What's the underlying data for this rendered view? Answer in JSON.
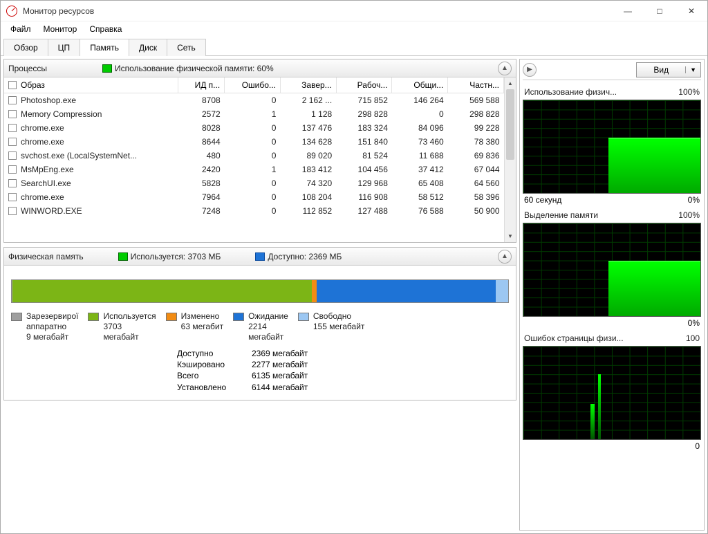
{
  "window": {
    "title": "Монитор ресурсов"
  },
  "menu": {
    "file": "Файл",
    "monitor": "Монитор",
    "help": "Справка"
  },
  "tabs": {
    "overview": "Обзор",
    "cpu": "ЦП",
    "memory": "Память",
    "disk": "Диск",
    "network": "Сеть"
  },
  "processes": {
    "title": "Процессы",
    "usage_label": "Использование физической памяти: 60%",
    "columns": {
      "image": "Образ",
      "pid": "ИД п...",
      "faults": "Ошибо...",
      "commit": "Завер...",
      "working": "Рабоч...",
      "shared": "Общи...",
      "private": "Частн..."
    },
    "rows": [
      {
        "image": "Photoshop.exe",
        "pid": "8708",
        "faults": "0",
        "commit": "2 162 ...",
        "working": "715 852",
        "shared": "146 264",
        "private": "569 588"
      },
      {
        "image": "Memory Compression",
        "pid": "2572",
        "faults": "1",
        "commit": "1 128",
        "working": "298 828",
        "shared": "0",
        "private": "298 828"
      },
      {
        "image": "chrome.exe",
        "pid": "8028",
        "faults": "0",
        "commit": "137 476",
        "working": "183 324",
        "shared": "84 096",
        "private": "99 228"
      },
      {
        "image": "chrome.exe",
        "pid": "8644",
        "faults": "0",
        "commit": "134 628",
        "working": "151 840",
        "shared": "73 460",
        "private": "78 380"
      },
      {
        "image": "svchost.exe (LocalSystemNet...",
        "pid": "480",
        "faults": "0",
        "commit": "89 020",
        "working": "81 524",
        "shared": "11 688",
        "private": "69 836"
      },
      {
        "image": "MsMpEng.exe",
        "pid": "2420",
        "faults": "1",
        "commit": "183 412",
        "working": "104 456",
        "shared": "37 412",
        "private": "67 044"
      },
      {
        "image": "SearchUI.exe",
        "pid": "5828",
        "faults": "0",
        "commit": "74 320",
        "working": "129 968",
        "shared": "65 408",
        "private": "64 560"
      },
      {
        "image": "chrome.exe",
        "pid": "7964",
        "faults": "0",
        "commit": "108 204",
        "working": "116 908",
        "shared": "58 512",
        "private": "58 396"
      },
      {
        "image": "WINWORD.EXE",
        "pid": "7248",
        "faults": "0",
        "commit": "112 852",
        "working": "127 488",
        "shared": "76 588",
        "private": "50 900"
      }
    ]
  },
  "physical_memory": {
    "title": "Физическая память",
    "in_use_label": "Используется: 3703 МБ",
    "available_label": "Доступно: 2369 МБ",
    "legend": {
      "reserved": {
        "label": "Зарезервирої",
        "sub": "аппаратно",
        "val": "9 мегабайт",
        "color": "#9e9e9e"
      },
      "in_use": {
        "label": "Используется",
        "val": "3703",
        "unit": "мегабайт",
        "color": "#7cb516"
      },
      "modified": {
        "label": "Изменено",
        "val": "63 мегабит",
        "color": "#f28c13"
      },
      "standby": {
        "label": "Ожидание",
        "val": "2214",
        "unit": "мегабайт",
        "color": "#1e73d6"
      },
      "free": {
        "label": "Свободно",
        "val": "155 мегабайт",
        "color": "#9cc7f2"
      }
    },
    "stats": {
      "available": {
        "k": "Доступно",
        "v": "2369 мегабайт"
      },
      "cached": {
        "k": "Кэшировано",
        "v": "2277 мегабайт"
      },
      "total": {
        "k": "Всего",
        "v": "6135 мегабайт"
      },
      "installed": {
        "k": "Установлено",
        "v": "6144 мегабайт"
      }
    }
  },
  "right": {
    "view_label": "Вид",
    "graphs": [
      {
        "title": "Использование физич...",
        "max": "100%",
        "footer_left": "60 секунд",
        "footer_right": "0%",
        "type": "step"
      },
      {
        "title": "Выделение памяти",
        "max": "100%",
        "footer_left": "",
        "footer_right": "0%",
        "type": "step"
      },
      {
        "title": "Ошибок страницы физи...",
        "max": "100",
        "footer_left": "",
        "footer_right": "0",
        "type": "spike"
      }
    ]
  },
  "chart_data": {
    "type": "bar",
    "title": "Физическая память",
    "categories": [
      "Зарезервировано аппаратно",
      "Используется",
      "Изменено",
      "Ожидание",
      "Свободно"
    ],
    "values": [
      9,
      3703,
      63,
      2214,
      155
    ],
    "unit": "МБ",
    "total": 6144
  }
}
